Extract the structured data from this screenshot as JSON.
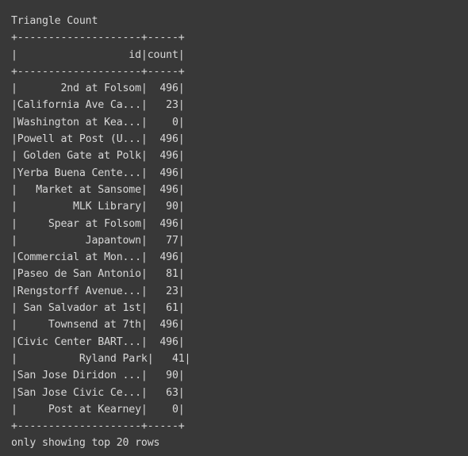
{
  "output": {
    "title": "Triangle Count",
    "border_top": "+--------------------+-----+",
    "header_row": "|                  id|count|",
    "border_mid": "+--------------------+-----+",
    "rows": [
      "|       2nd at Folsom|  496|",
      "|California Ave Ca...|   23|",
      "|Washington at Kea...|    0|",
      "|Powell at Post (U...|  496|",
      "| Golden Gate at Polk|  496|",
      "|Yerba Buena Cente...|  496|",
      "|   Market at Sansome|  496|",
      "|         MLK Library|   90|",
      "|     Spear at Folsom|  496|",
      "|           Japantown|   77|",
      "|Commercial at Mon...|  496|",
      "|Paseo de San Antonio|   81|",
      "|Rengstorff Avenue...|   23|",
      "| San Salvador at 1st|   61|",
      "|     Townsend at 7th|  496|",
      "|Civic Center BART...|  496|",
      "|          Ryland Park|   41|",
      "|San Jose Diridon ...|   90|",
      "|San Jose Civic Ce...|   63|",
      "|     Post at Kearney|    0|"
    ],
    "border_bottom": "+--------------------+-----+",
    "footer": "only showing top 20 rows"
  }
}
